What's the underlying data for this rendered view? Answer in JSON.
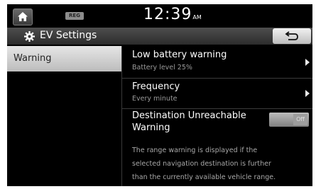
{
  "status_bar": {
    "reg_badge": "REG",
    "time": "12:39",
    "ampm": "AM"
  },
  "title_bar": {
    "title": "EV Settings",
    "icon": "gear-icon",
    "back_icon": "back-arrow-icon"
  },
  "left_menu": {
    "items": [
      {
        "label": "Warning",
        "selected": true
      }
    ]
  },
  "settings": {
    "low_battery": {
      "title": "Low battery warning",
      "subtitle": "Battery level 25%"
    },
    "frequency": {
      "title": "Frequency",
      "subtitle": "Every minute"
    },
    "destination": {
      "title_line1": "Destination Unreachable",
      "title_line2": "Warning",
      "toggle_label": "Off"
    },
    "description_lines": [
      "The range warning is displayed if the",
      "selected navigation destination is further",
      "than the currently available vehicle range."
    ]
  },
  "colors": {
    "background": "#000000",
    "selected_item": "#d0d0d0",
    "subtitle": "#9a9a9a"
  }
}
